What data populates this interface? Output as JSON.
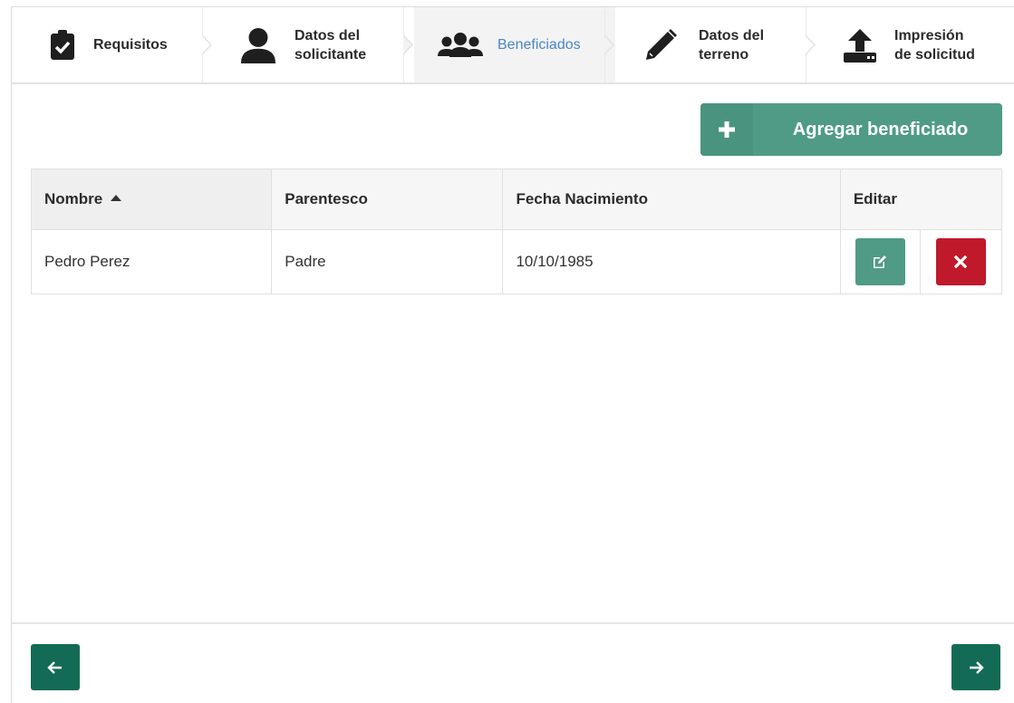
{
  "steps": [
    {
      "label": "Requisitos",
      "icon": "clipboard-check-icon"
    },
    {
      "label_line1": "Datos del",
      "label_line2": "solicitante",
      "icon": "user-icon"
    },
    {
      "label": "Beneficiados",
      "icon": "users-icon",
      "active": true
    },
    {
      "label_line1": "Datos del",
      "label_line2": "terreno",
      "icon": "pencil-icon"
    },
    {
      "label_line1": "Impresión",
      "label_line2": "de solicitud",
      "icon": "upload-icon"
    }
  ],
  "actions": {
    "add_label": "Agregar beneficiado"
  },
  "table": {
    "headers": [
      "Nombre",
      "Parentesco",
      "Fecha Nacimiento",
      "Editar"
    ],
    "sort_column": "Nombre",
    "rows": [
      {
        "nombre": "Pedro Perez",
        "parentesco": "Padre",
        "fecha": "10/10/1985"
      }
    ]
  },
  "colors": {
    "primary": "#4f9b86",
    "danger": "#c0192c",
    "nav": "#136b56",
    "active_step_text": "#4a86c5"
  }
}
